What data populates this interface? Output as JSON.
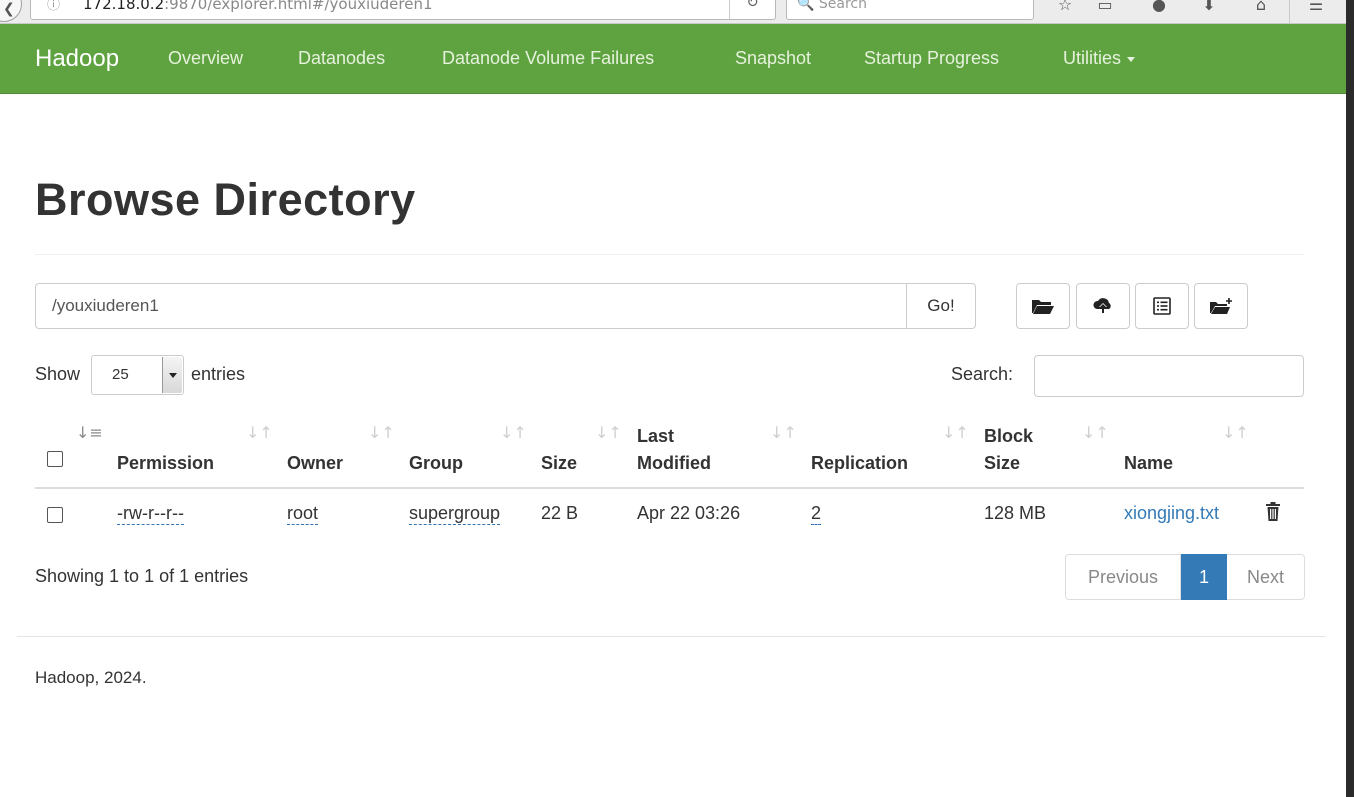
{
  "browser": {
    "url_host": "172.18.0.2",
    "url_rest": ":9870/explorer.html#/youxiuderen1",
    "search_placeholder": "Search"
  },
  "navbar": {
    "brand": "Hadoop",
    "items": [
      "Overview",
      "Datanodes",
      "Datanode Volume Failures",
      "Snapshot",
      "Startup Progress",
      "Utilities"
    ]
  },
  "page": {
    "title": "Browse Directory",
    "path": "/youxiuderen1",
    "go_label": "Go!"
  },
  "toolbar": {
    "icons": [
      "folder-open-icon",
      "cloud-upload-icon",
      "list-alt-icon",
      "new-folder-icon"
    ]
  },
  "table_controls": {
    "show_label": "Show",
    "page_length": "25",
    "entries_label": "entries",
    "search_label": "Search:"
  },
  "table": {
    "headers": {
      "permission": "Permission",
      "owner": "Owner",
      "group": "Group",
      "size": "Size",
      "last_modified_1": "Last",
      "last_modified_2": "Modified",
      "replication": "Replication",
      "block_size_1": "Block",
      "block_size_2": "Size",
      "name": "Name"
    },
    "rows": [
      {
        "permission": "-rw-r--r--",
        "owner": "root",
        "group": "supergroup",
        "size": "22 B",
        "last_modified": "Apr 22 03:26",
        "replication": "2",
        "block_size": "128 MB",
        "name": "xiongjing.txt"
      }
    ]
  },
  "pagination": {
    "info": "Showing 1 to 1 of 1 entries",
    "previous": "Previous",
    "current": "1",
    "next": "Next"
  },
  "footer": {
    "text": "Hadoop, 2024."
  },
  "colors": {
    "navbar": "#5fa341",
    "link": "#337ab7",
    "active_page": "#337ab7"
  }
}
